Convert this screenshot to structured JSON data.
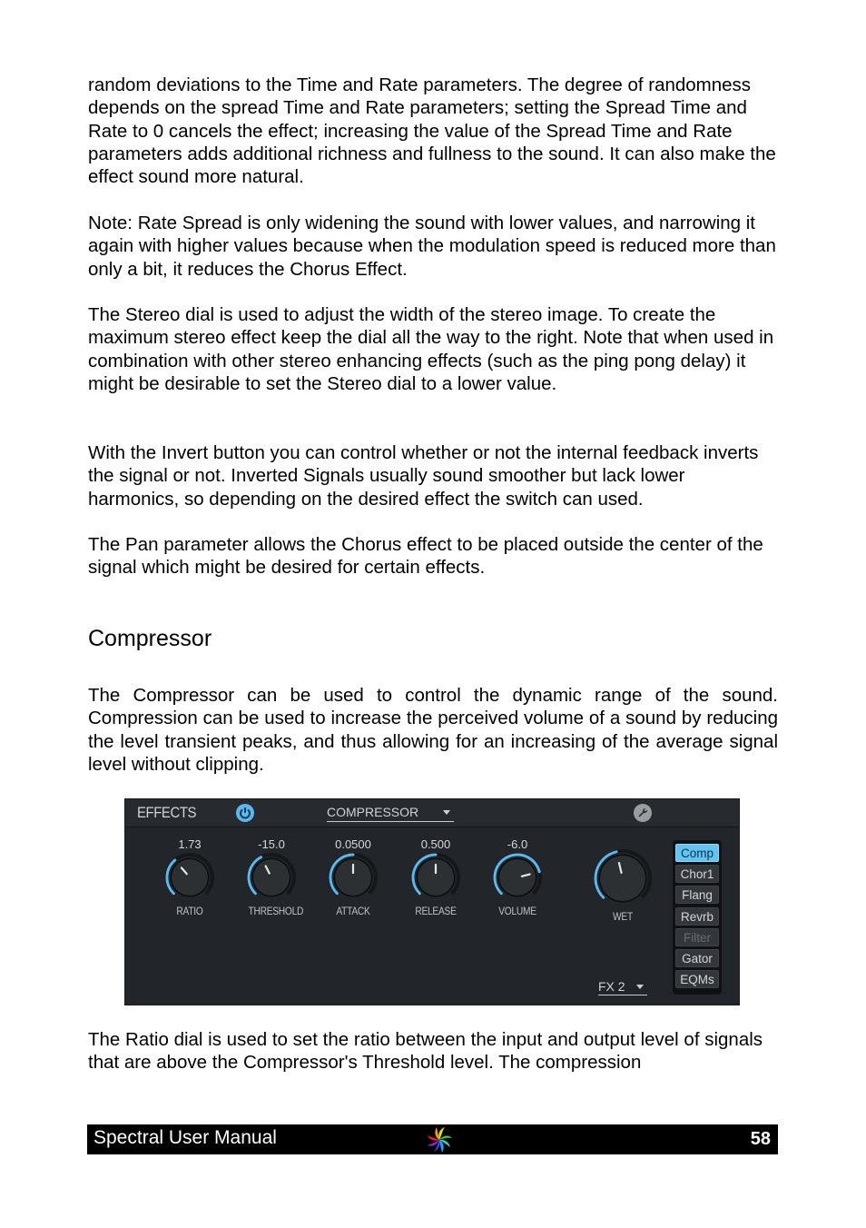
{
  "paragraphs": {
    "p1": "random deviations to the Time and Rate parameters. The degree of randomness depends on the spread Time and Rate parameters; setting the Spread Time and Rate to 0 cancels the effect; increasing the value of the Spread Time and Rate parameters adds additional richness and fullness to the sound. It can also make the effect sound more natural.",
    "p2": "Note: Rate Spread is only widening the sound with lower values, and narrowing it again with higher values because when the modulation speed is reduced more than only a bit, it reduces the Chorus Effect.",
    "p3": "The Stereo dial is used to adjust the width of the stereo image. To create the maximum stereo effect keep the dial all the way to the right. Note that when used in combination with other stereo enhancing effects (such as the ping pong delay) it might be desirable to set the Stereo dial to a lower value.",
    "p4": "With the Invert button you can control whether or not the internal feedback inverts the signal or not. Inverted Signals usually sound smoother but lack lower harmonics, so depending on the desired effect the switch can used.",
    "p5": "The Pan parameter allows the Chorus effect to be placed outside the center of the signal which might be desired for certain effects.",
    "p6": "The Compressor can be used to control the dynamic range of the sound. Compression can be used to increase the perceived volume of a sound by reducing the level transient peaks, and thus allowing for an increasing of the average signal level without clipping.",
    "p7": "The Ratio dial is used to set the ratio between the input and output level of signals that are above the Compressor's Threshold level. The compression"
  },
  "section_heading": "Compressor",
  "effects_panel": {
    "title": "EFFECTS",
    "effect_select": "COMPRESSOR",
    "slot_select": "FX 2",
    "accent_color": "#5ab8ec",
    "knobs": [
      {
        "label": "RATIO",
        "value": "1.73",
        "position": 0.35
      },
      {
        "label": "THRESHOLD",
        "value": "-15.0",
        "position": 0.4
      },
      {
        "label": "ATTACK",
        "value": "0.0500",
        "position": 0.5
      },
      {
        "label": "RELEASE",
        "value": "0.500",
        "position": 0.5
      },
      {
        "label": "VOLUME",
        "value": "-6.0",
        "position": 0.78
      },
      {
        "label": "WET",
        "value": "",
        "position": 0.45
      }
    ],
    "effect_buttons": [
      {
        "label": "Comp",
        "state": "active"
      },
      {
        "label": "Chor1",
        "state": "normal"
      },
      {
        "label": "Flang",
        "state": "normal"
      },
      {
        "label": "Revrb",
        "state": "normal"
      },
      {
        "label": "Filter",
        "state": "disabled"
      },
      {
        "label": "Gator",
        "state": "normal"
      },
      {
        "label": "EQMs",
        "state": "normal"
      }
    ]
  },
  "footer": {
    "title": "Spectral User Manual",
    "page_number": "58"
  }
}
